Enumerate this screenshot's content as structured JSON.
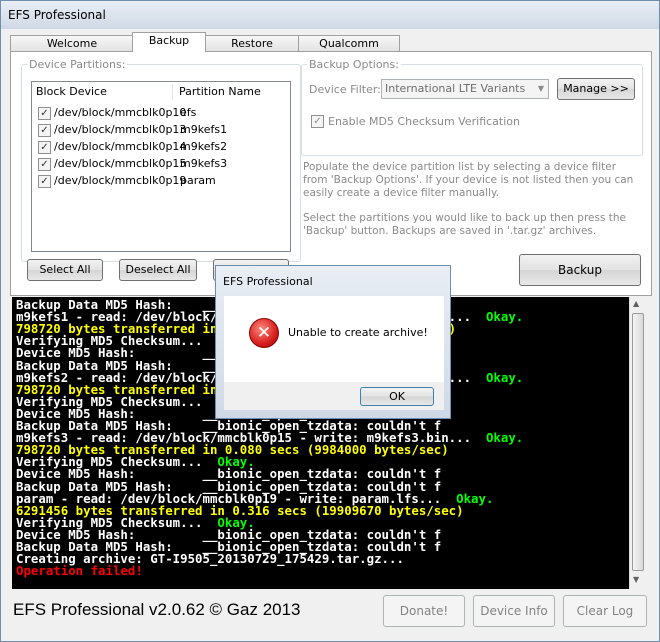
{
  "window": {
    "title": "EFS Professional"
  },
  "tabs": [
    {
      "label": "Welcome"
    },
    {
      "label": "Backup"
    },
    {
      "label": "Restore"
    },
    {
      "label": "Qualcomm"
    }
  ],
  "device_partitions": {
    "legend": "Device Partitions:",
    "columns": [
      "Block Device",
      "Partition Name"
    ],
    "rows": [
      {
        "device": "/dev/block/mmcblk0p10",
        "name": "efs"
      },
      {
        "device": "/dev/block/mmcblk0p13",
        "name": "m9kefs1"
      },
      {
        "device": "/dev/block/mmcblk0p14",
        "name": "m9kefs2"
      },
      {
        "device": "/dev/block/mmcblk0p15",
        "name": "m9kefs3"
      },
      {
        "device": "/dev/block/mmcblk0p19",
        "name": "param"
      }
    ],
    "select_all": "Select All",
    "deselect_all": "Deselect All",
    "refresh_partial": "Refresh List"
  },
  "backup_options": {
    "legend": "Backup Options:",
    "device_filter_label": "Device Filter:",
    "device_filter_value": "International LTE Variants",
    "manage_button": "Manage >>",
    "md5_checkbox": "Enable MD5 Checksum Verification"
  },
  "info": {
    "para1": "Populate the device partition list by selecting a device filter from 'Backup Options'. If your device is not listed then you can easily create a device filter manually.",
    "para2": "Select the partitions you would like to back up then press the 'Backup' button. Backups are saved in '.tar.gz' archives."
  },
  "backup_button": "Backup",
  "console": [
    {
      "segs": [
        {
          "t": "Backup Data MD5 Hash:    __bionic_open_tzdata: couldn't f",
          "c": "white"
        }
      ]
    },
    {
      "segs": [
        {
          "t": "m9kefs1 - read: /dev/block/mmcblk0p13 - write: m9kefs1.bin...  ",
          "c": "white"
        },
        {
          "t": "Okay.",
          "c": "green"
        }
      ]
    },
    {
      "segs": [
        {
          "t": "798720 bytes transferred in 0.070 secs (11410285 bytes/sec)",
          "c": "yellow"
        }
      ]
    },
    {
      "segs": [
        {
          "t": "Verifying MD5 Checksum...  ",
          "c": "white"
        },
        {
          "t": "Okay.",
          "c": "green"
        }
      ]
    },
    {
      "segs": [
        {
          "t": "Device MD5 Hash:         __bionic_open_tzdata: couldn't f",
          "c": "white"
        }
      ]
    },
    {
      "segs": [
        {
          "t": "Backup Data MD5 Hash:    __bionic_open_tzdata: couldn't f",
          "c": "white"
        }
      ]
    },
    {
      "segs": [
        {
          "t": "m9kefs2 - read: /dev/block/mmcblk0p14 - write: m9kefs2.bin...  ",
          "c": "white"
        },
        {
          "t": "Okay.",
          "c": "green"
        }
      ]
    },
    {
      "segs": [
        {
          "t": "798720 bytes transferred in 0.080 secs (9984000 bytes/sec)",
          "c": "yellow"
        }
      ]
    },
    {
      "segs": [
        {
          "t": "Verifying MD5 Checksum...  ",
          "c": "white"
        },
        {
          "t": "Okay.",
          "c": "green"
        }
      ]
    },
    {
      "segs": [
        {
          "t": "Device MD5 Hash:         __bionic_open_tzdata: couldn't f",
          "c": "white"
        }
      ]
    },
    {
      "segs": [
        {
          "t": "Backup Data MD5 Hash:    __bionic_open_tzdata: couldn't f",
          "c": "white"
        }
      ]
    },
    {
      "segs": [
        {
          "t": "m9kefs3 - read: /dev/block/mmcblk0p15 - write: m9kefs3.bin...  ",
          "c": "white"
        },
        {
          "t": "Okay.",
          "c": "green"
        }
      ]
    },
    {
      "segs": [
        {
          "t": "798720 bytes transferred in 0.080 secs (9984000 bytes/sec)",
          "c": "yellow"
        }
      ]
    },
    {
      "segs": [
        {
          "t": "Verifying MD5 Checksum...  ",
          "c": "white"
        },
        {
          "t": "Okay.",
          "c": "green"
        }
      ]
    },
    {
      "segs": [
        {
          "t": "Device MD5 Hash:         __bionic_open_tzdata: couldn't f",
          "c": "white"
        }
      ]
    },
    {
      "segs": [
        {
          "t": "Backup Data MD5 Hash:    __bionic_open_tzdata: couldn't f",
          "c": "white"
        }
      ]
    },
    {
      "segs": [
        {
          "t": "param - read: /dev/block/mmcblk0p19 - write: param.lfs...  ",
          "c": "white"
        },
        {
          "t": "Okay.",
          "c": "green"
        }
      ]
    },
    {
      "segs": [
        {
          "t": "6291456 bytes transferred in 0.316 secs (19909670 bytes/sec)",
          "c": "yellow"
        }
      ]
    },
    {
      "segs": [
        {
          "t": "Verifying MD5 Checksum...  ",
          "c": "white"
        },
        {
          "t": "Okay.",
          "c": "green"
        }
      ]
    },
    {
      "segs": [
        {
          "t": "Device MD5 Hash:         __bionic_open_tzdata: couldn't f",
          "c": "white"
        }
      ]
    },
    {
      "segs": [
        {
          "t": "Backup Data MD5 Hash:    __bionic_open_tzdata: couldn't f",
          "c": "white"
        }
      ]
    },
    {
      "segs": [
        {
          "t": "Creating archive: GT-I9505_20130729_175429.tar.gz...",
          "c": "white"
        }
      ]
    },
    {
      "segs": [
        {
          "t": "Operation failed!",
          "c": "red"
        }
      ]
    }
  ],
  "footer": {
    "title": "EFS Professional v2.0.62 © Gaz 2013",
    "donate": "Donate!",
    "device_info": "Device Info",
    "clear_log": "Clear Log"
  },
  "dialog": {
    "title": "EFS Professional",
    "message": "Unable to create archive!",
    "ok": "OK"
  },
  "colors": {
    "console_bg": "#000000",
    "ok_green": "#00ff00",
    "info_yellow": "#ffff00",
    "error_red": "#ff0000"
  }
}
